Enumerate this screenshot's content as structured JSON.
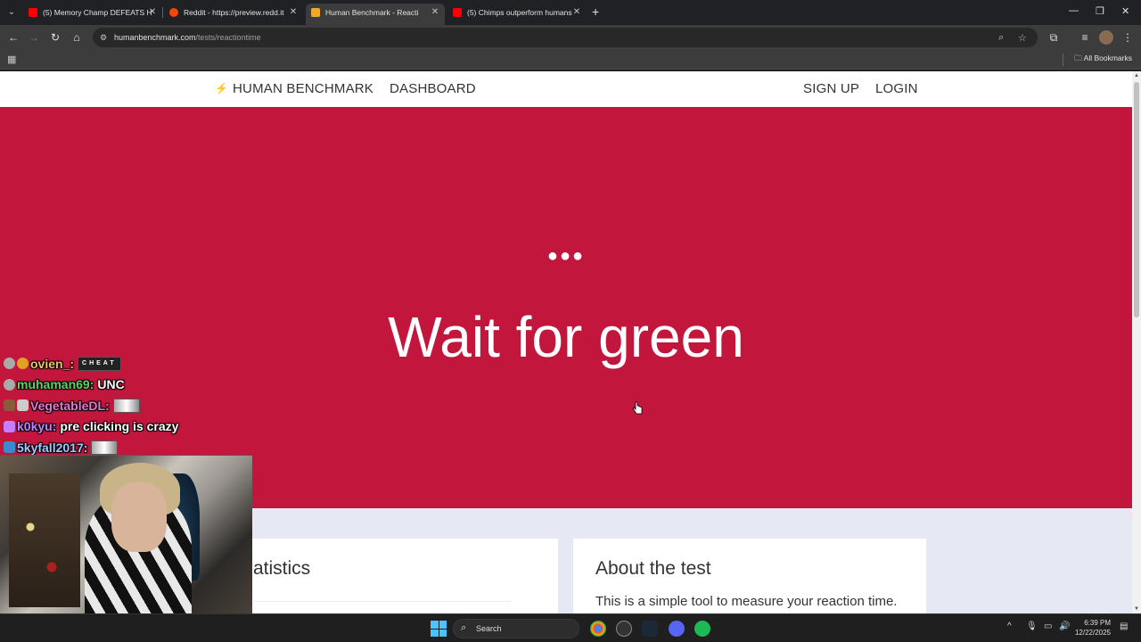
{
  "browser": {
    "tabs": [
      {
        "title": "(5) Memory Champ DEFEATS H",
        "favicon_color": "#ff0000",
        "active": false
      },
      {
        "title": "Reddit - https://preview.redd.it",
        "favicon_color": "#ff4500",
        "active": false
      },
      {
        "title": "Human Benchmark - Reacti",
        "favicon_color": "#f5a623",
        "active": true
      },
      {
        "title": "(5) Chimps outperform humans",
        "favicon_color": "#ff0000",
        "active": false
      }
    ],
    "url_host": "humanbenchmark.com",
    "url_path": "/tests/reactiontime",
    "all_bookmarks": "All Bookmarks"
  },
  "site": {
    "brand": "HUMAN BENCHMARK",
    "dashboard": "DASHBOARD",
    "signup": "SIGN UP",
    "login": "LOGIN",
    "hero_dots": "●●●",
    "hero_title": "Wait for green",
    "hero_color": "#c2163c",
    "stats_title": "atistics",
    "about_title": "About the test",
    "about_text": "This is a simple tool to measure your reaction time."
  },
  "chat": [
    {
      "user": "ovien_:",
      "user_color": "#f0c060",
      "message": "",
      "emote": "CHEAT"
    },
    {
      "user": "muhaman69:",
      "user_color": "#5fd35f",
      "message": "UNC",
      "emote": ""
    },
    {
      "user": "VegetableDL:",
      "user_color": "#e07bd0",
      "message": "",
      "emote": ""
    },
    {
      "user": "k0kyu:",
      "user_color": "#c77dff",
      "message": "pre clicking is crazy",
      "emote": ""
    },
    {
      "user": "5kyfall2017:",
      "user_color": "#9ec9ff",
      "message": "",
      "emote": ""
    }
  ],
  "taskbar": {
    "search_label": "Search",
    "time": "6:39 PM",
    "date": "12/22/2025"
  }
}
